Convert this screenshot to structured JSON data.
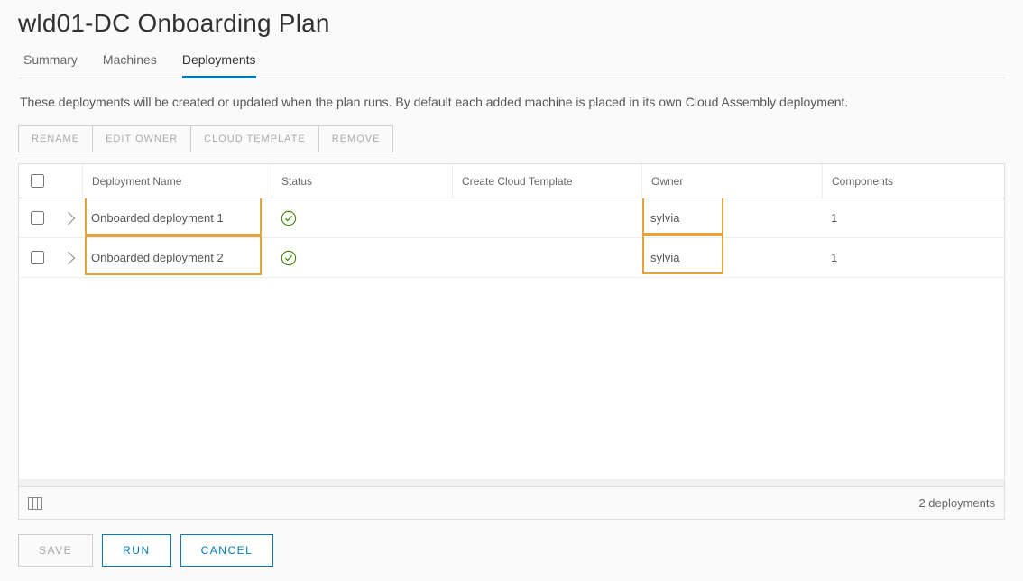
{
  "header": {
    "title": "wld01-DC Onboarding Plan"
  },
  "tabs": [
    {
      "label": "Summary",
      "active": false
    },
    {
      "label": "Machines",
      "active": false
    },
    {
      "label": "Deployments",
      "active": true
    }
  ],
  "description": "These deployments will be created or updated when the plan runs. By default each added machine is placed in its own Cloud Assembly deployment.",
  "toolbar": {
    "rename": "RENAME",
    "edit_owner": "EDIT OWNER",
    "cloud_template": "CLOUD TEMPLATE",
    "remove": "REMOVE"
  },
  "table": {
    "headers": {
      "deployment_name": "Deployment Name",
      "status": "Status",
      "create_cloud_template": "Create Cloud Template",
      "owner": "Owner",
      "components": "Components"
    },
    "rows": [
      {
        "name": "Onboarded deployment 1",
        "status_icon": "success",
        "create_cloud_template": "",
        "owner": "sylvia",
        "components": "1"
      },
      {
        "name": "Onboarded deployment 2",
        "status_icon": "success",
        "create_cloud_template": "",
        "owner": "sylvia",
        "components": "1"
      }
    ],
    "footer_count": "2 deployments"
  },
  "actions": {
    "save": "SAVE",
    "run": "RUN",
    "cancel": "CANCEL"
  },
  "icons": {
    "chevron_right": "chevron-right-icon",
    "check_circle": "check-circle-icon",
    "columns_toggle": "columns-toggle-icon"
  },
  "colors": {
    "accent": "#007cbb",
    "highlight": "#e8a33d",
    "success": "#3c8500"
  }
}
